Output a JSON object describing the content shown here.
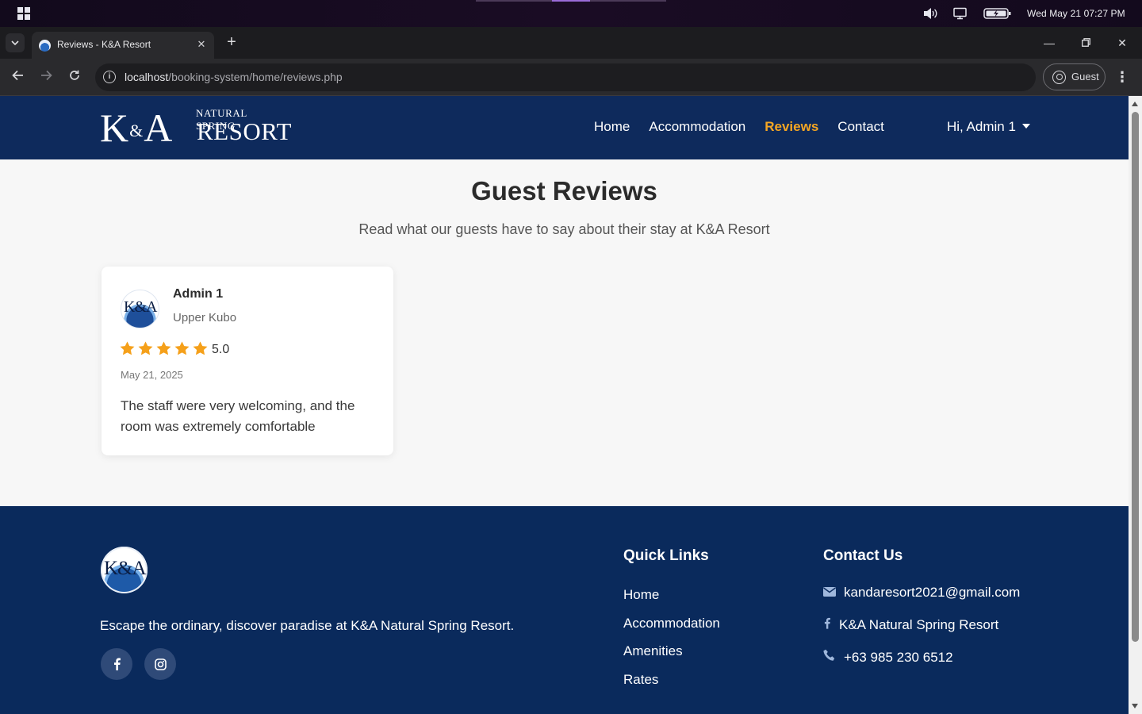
{
  "os": {
    "clock": "Wed May 21  07:27 PM"
  },
  "browser": {
    "tab_title": "Reviews - K&A Resort",
    "url_host": "localhost",
    "url_path": "/booking-system/home/reviews.php",
    "profile_label": "Guest"
  },
  "header": {
    "logo_main": "K",
    "logo_amp": "&",
    "logo_main2": "A",
    "logo_sub1": "NATURAL SPRING",
    "logo_sub2": "RESORT",
    "nav": [
      {
        "label": "Home"
      },
      {
        "label": "Accommodation"
      },
      {
        "label": "Reviews"
      },
      {
        "label": "Contact"
      }
    ],
    "user_greeting": "Hi, Admin 1"
  },
  "main": {
    "title": "Guest Reviews",
    "subtitle": "Read what our guests have to say about their stay at K&A Resort",
    "reviews": [
      {
        "avatar_text": "K&A",
        "name": "Admin 1",
        "location": "Upper Kubo",
        "stars": 5,
        "rating": "5.0",
        "date": "May 21, 2025",
        "comment": "The staff were very welcoming, and the room was extremely comfortable"
      }
    ]
  },
  "footer": {
    "logo_text": "K&A",
    "tagline": "Escape the ordinary, discover paradise at K&A Natural Spring Resort.",
    "quick_links_heading": "Quick Links",
    "quick_links": [
      {
        "label": "Home"
      },
      {
        "label": "Accommodation"
      },
      {
        "label": "Amenities"
      },
      {
        "label": "Rates"
      }
    ],
    "contact_heading": "Contact Us",
    "contact": {
      "email": "kandaresort2021@gmail.com",
      "facebook": "K&A Natural Spring Resort",
      "phone": "+63 985 230 6512"
    }
  },
  "colors": {
    "header_bg": "#0e2a5c",
    "footer_bg": "#0a2a5c",
    "accent": "#f5a623",
    "star": "#f5a01a"
  }
}
